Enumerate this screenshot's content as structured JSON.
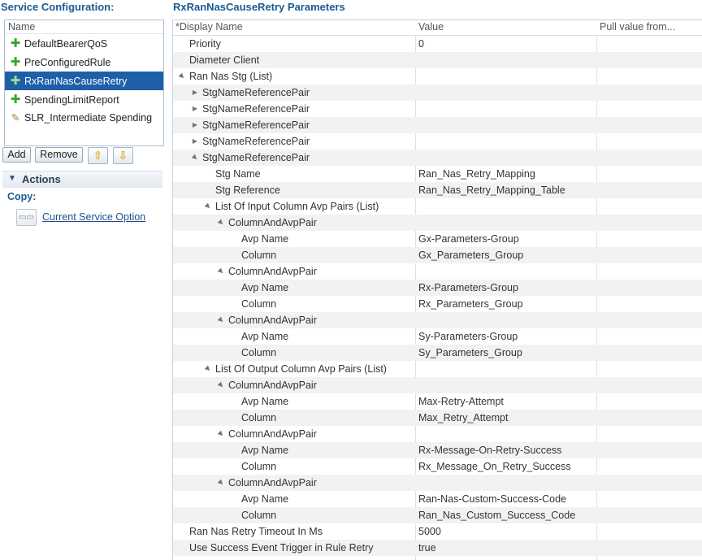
{
  "left_panel": {
    "title": "Service Configuration:",
    "list_header": "Name",
    "services": [
      {
        "label": "DefaultBearerQoS",
        "icon": "plus-icon",
        "selected": false
      },
      {
        "label": "PreConfiguredRule",
        "icon": "plus-icon",
        "selected": false
      },
      {
        "label": "RxRanNasCauseRetry",
        "icon": "plus-icon",
        "selected": true
      },
      {
        "label": "SpendingLimitReport",
        "icon": "plus-icon",
        "selected": false
      },
      {
        "label": "SLR_Intermediate Spending",
        "icon": "pencil-icon",
        "selected": false
      }
    ],
    "buttons": {
      "add": "Add",
      "remove": "Remove"
    },
    "actions_label": "Actions",
    "copy_label": "Copy:",
    "copy_link": "Current Service Option"
  },
  "params": {
    "title": "RxRanNasCauseRetry Parameters",
    "columns": [
      "*Display Name",
      "Value",
      "Pull value from..."
    ],
    "rows": [
      {
        "name": "Priority",
        "value": "0",
        "level": 1,
        "toggle": "none"
      },
      {
        "name": "Diameter Client",
        "value": "",
        "level": 1,
        "toggle": "none"
      },
      {
        "name": "Ran Nas Stg (List)",
        "value": "",
        "level": 1,
        "toggle": "expanded"
      },
      {
        "name": "StgNameReferencePair",
        "value": "",
        "level": 2,
        "toggle": "collapsed"
      },
      {
        "name": "StgNameReferencePair",
        "value": "",
        "level": 2,
        "toggle": "collapsed"
      },
      {
        "name": "StgNameReferencePair",
        "value": "",
        "level": 2,
        "toggle": "collapsed"
      },
      {
        "name": "StgNameReferencePair",
        "value": "",
        "level": 2,
        "toggle": "collapsed"
      },
      {
        "name": "StgNameReferencePair",
        "value": "",
        "level": 2,
        "toggle": "expanded"
      },
      {
        "name": "Stg Name",
        "value": "Ran_Nas_Retry_Mapping",
        "level": 3,
        "toggle": "none"
      },
      {
        "name": "Stg Reference",
        "value": "Ran_Nas_Retry_Mapping_Table",
        "level": 3,
        "toggle": "none"
      },
      {
        "name": "List Of Input Column Avp Pairs (List)",
        "value": "",
        "level": 3,
        "toggle": "expanded"
      },
      {
        "name": "ColumnAndAvpPair",
        "value": "",
        "level": 4,
        "toggle": "expanded"
      },
      {
        "name": "Avp Name",
        "value": "Gx-Parameters-Group",
        "level": 5,
        "toggle": "none"
      },
      {
        "name": "Column",
        "value": "Gx_Parameters_Group",
        "level": 5,
        "toggle": "none"
      },
      {
        "name": "ColumnAndAvpPair",
        "value": "",
        "level": 4,
        "toggle": "expanded"
      },
      {
        "name": "Avp Name",
        "value": "Rx-Parameters-Group",
        "level": 5,
        "toggle": "none"
      },
      {
        "name": "Column",
        "value": "Rx_Parameters_Group",
        "level": 5,
        "toggle": "none"
      },
      {
        "name": "ColumnAndAvpPair",
        "value": "",
        "level": 4,
        "toggle": "expanded"
      },
      {
        "name": "Avp Name",
        "value": "Sy-Parameters-Group",
        "level": 5,
        "toggle": "none"
      },
      {
        "name": "Column",
        "value": "Sy_Parameters_Group",
        "level": 5,
        "toggle": "none"
      },
      {
        "name": "List Of Output Column Avp Pairs (List)",
        "value": "",
        "level": 3,
        "toggle": "expanded"
      },
      {
        "name": "ColumnAndAvpPair",
        "value": "",
        "level": 4,
        "toggle": "expanded"
      },
      {
        "name": "Avp Name",
        "value": "Max-Retry-Attempt",
        "level": 5,
        "toggle": "none"
      },
      {
        "name": "Column",
        "value": "Max_Retry_Attempt",
        "level": 5,
        "toggle": "none"
      },
      {
        "name": "ColumnAndAvpPair",
        "value": "",
        "level": 4,
        "toggle": "expanded"
      },
      {
        "name": "Avp Name",
        "value": "Rx-Message-On-Retry-Success",
        "level": 5,
        "toggle": "none"
      },
      {
        "name": "Column",
        "value": "Rx_Message_On_Retry_Success",
        "level": 5,
        "toggle": "none"
      },
      {
        "name": "ColumnAndAvpPair",
        "value": "",
        "level": 4,
        "toggle": "expanded"
      },
      {
        "name": "Avp Name",
        "value": "Ran-Nas-Custom-Success-Code",
        "level": 5,
        "toggle": "none"
      },
      {
        "name": "Column",
        "value": "Ran_Nas_Custom_Success_Code",
        "level": 5,
        "toggle": "none"
      },
      {
        "name": "Ran Nas Retry Timeout In Ms",
        "value": "5000",
        "level": 1,
        "toggle": "none"
      },
      {
        "name": "Use Success Event Trigger in Rule Retry",
        "value": "true",
        "level": 1,
        "toggle": "none"
      }
    ]
  }
}
